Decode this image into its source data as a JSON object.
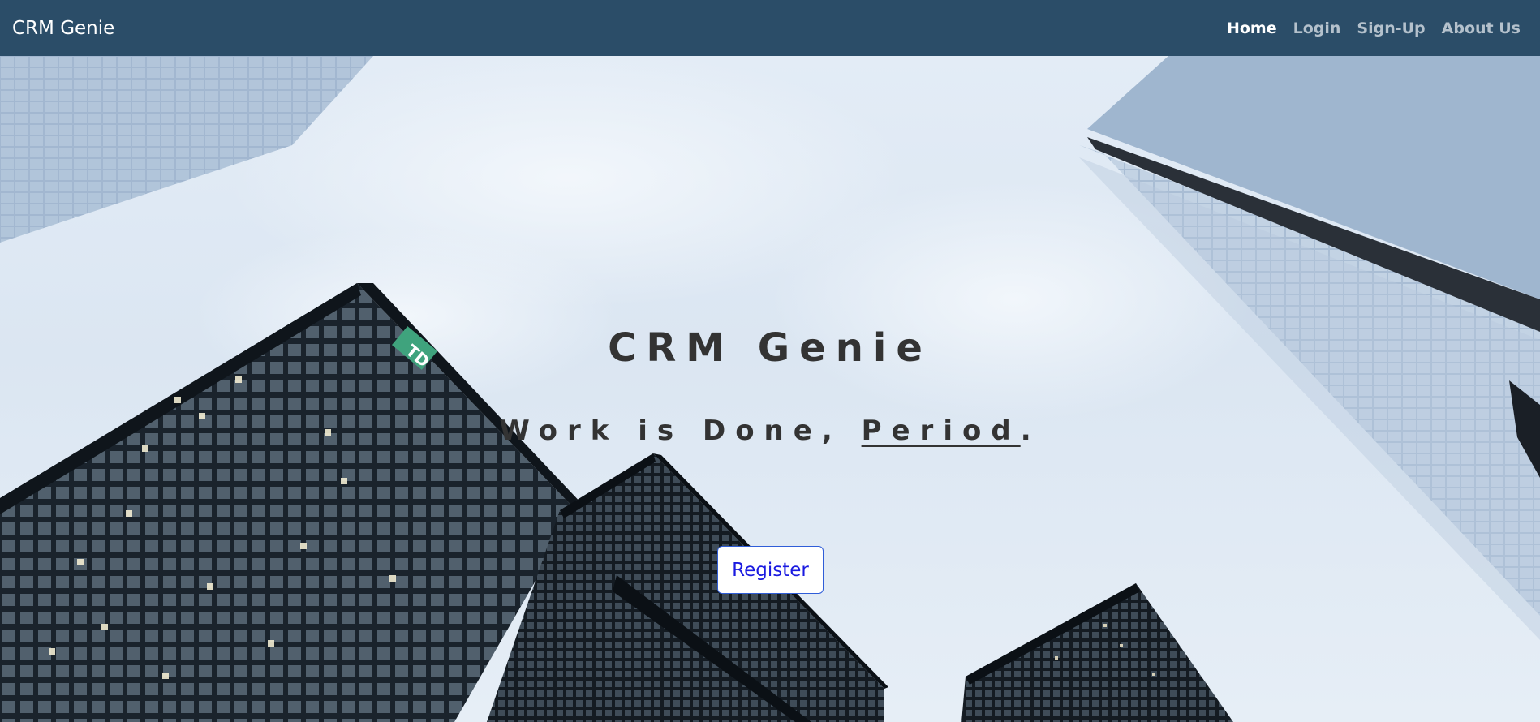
{
  "navbar": {
    "brand": "CRM Genie",
    "links": [
      {
        "label": "Home",
        "active": true
      },
      {
        "label": "Login",
        "active": false
      },
      {
        "label": "Sign-Up",
        "active": false
      },
      {
        "label": "About Us",
        "active": false
      }
    ]
  },
  "hero": {
    "title": "CRM Genie",
    "tagline_prefix": "Work is Done, ",
    "tagline_period_word": "Period",
    "tagline_suffix": ".",
    "register_label": "Register",
    "building_sign": "TD"
  },
  "colors": {
    "navbar_bg": "#2b4d68",
    "nav_inactive": "#b4c1cc",
    "nav_active": "#ffffff",
    "heading_text": "#333333",
    "button_text": "#1a1ae0",
    "button_border": "#2f5dd8"
  }
}
